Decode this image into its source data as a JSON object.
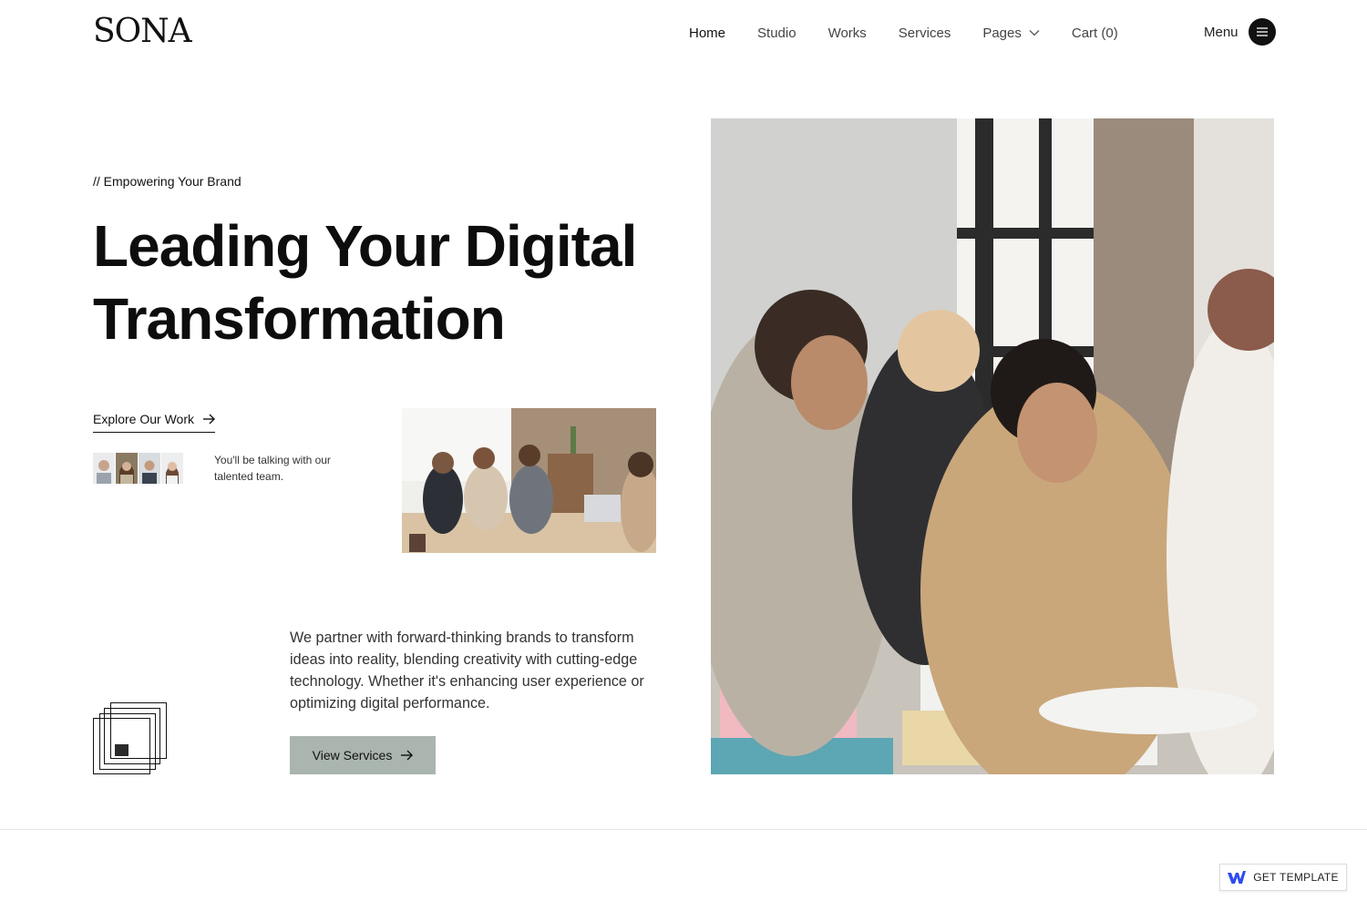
{
  "brand": {
    "logo": "SONA"
  },
  "nav": {
    "items": [
      {
        "label": "Home"
      },
      {
        "label": "Studio"
      },
      {
        "label": "Works"
      },
      {
        "label": "Services"
      },
      {
        "label": "Pages"
      },
      {
        "label": "Cart (0)"
      }
    ],
    "menu_label": "Menu"
  },
  "hero": {
    "eyebrow": "// Empowering Your Brand",
    "headline": "Leading Your Digital Transformation",
    "explore_link": "Explore Our Work",
    "team_text": "You'll be talking with our talented team.",
    "intro": "We partner with forward-thinking brands to transform ideas into reality, blending creativity with cutting-edge technology. Whether it's enhancing user experience or optimizing digital performance.",
    "cta_label": "View Services"
  },
  "badge": {
    "label": "GET TEMPLATE"
  },
  "colors": {
    "text": "#111111",
    "cta_background": "#a9b5ae",
    "badge_accent": "#2f4bf0"
  },
  "icons": [
    "chevron-down-icon",
    "hamburger-icon",
    "arrow-right-icon",
    "webflow-icon"
  ]
}
